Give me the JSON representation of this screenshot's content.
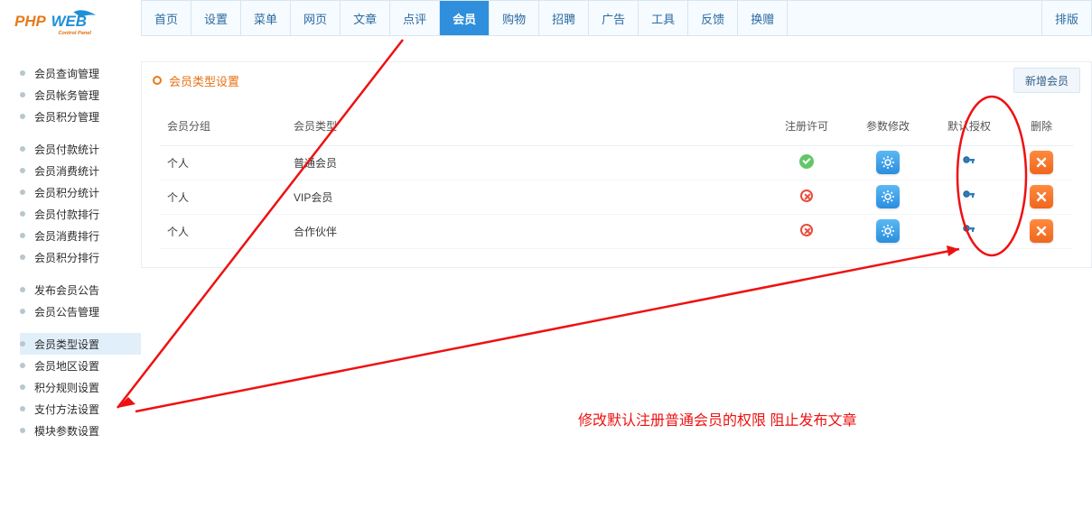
{
  "logo": {
    "name": "PHPWEB",
    "subtitle": "Control Panel"
  },
  "topnav": {
    "items": [
      {
        "label": "首页"
      },
      {
        "label": "设置"
      },
      {
        "label": "菜单"
      },
      {
        "label": "网页"
      },
      {
        "label": "文章"
      },
      {
        "label": "点评"
      },
      {
        "label": "会员",
        "active": true
      },
      {
        "label": "购物"
      },
      {
        "label": "招聘"
      },
      {
        "label": "广告"
      },
      {
        "label": "工具"
      },
      {
        "label": "反馈"
      },
      {
        "label": "换赠"
      }
    ],
    "right_label": "排版"
  },
  "sidenav": {
    "groups": [
      [
        {
          "label": "会员查询管理"
        },
        {
          "label": "会员帐务管理"
        },
        {
          "label": "会员积分管理"
        }
      ],
      [
        {
          "label": "会员付款统计"
        },
        {
          "label": "会员消费统计"
        },
        {
          "label": "会员积分统计"
        },
        {
          "label": "会员付款排行"
        },
        {
          "label": "会员消费排行"
        },
        {
          "label": "会员积分排行"
        }
      ],
      [
        {
          "label": "发布会员公告"
        },
        {
          "label": "会员公告管理"
        }
      ],
      [
        {
          "label": "会员类型设置",
          "selected": true
        },
        {
          "label": "会员地区设置"
        },
        {
          "label": "积分规则设置"
        },
        {
          "label": "支付方法设置"
        },
        {
          "label": "模块参数设置"
        }
      ]
    ]
  },
  "panel": {
    "title": "会员类型设置",
    "add_button": "新增会员",
    "columns": {
      "group": "会员分组",
      "type": "会员类型",
      "reg": "注册许可",
      "param": "参数修改",
      "auth": "默认授权",
      "del": "删除"
    },
    "rows": [
      {
        "group": "个人",
        "type": "普通会员",
        "reg_allow": true
      },
      {
        "group": "个人",
        "type": "VIP会员",
        "reg_allow": false
      },
      {
        "group": "个人",
        "type": "合作伙伴",
        "reg_allow": false
      }
    ]
  },
  "annotation": {
    "text": "修改默认注册普通会员的权限  阻止发布文章"
  },
  "icons": {
    "gear": "gear-icon",
    "key": "key-icon",
    "close": "close-icon"
  }
}
